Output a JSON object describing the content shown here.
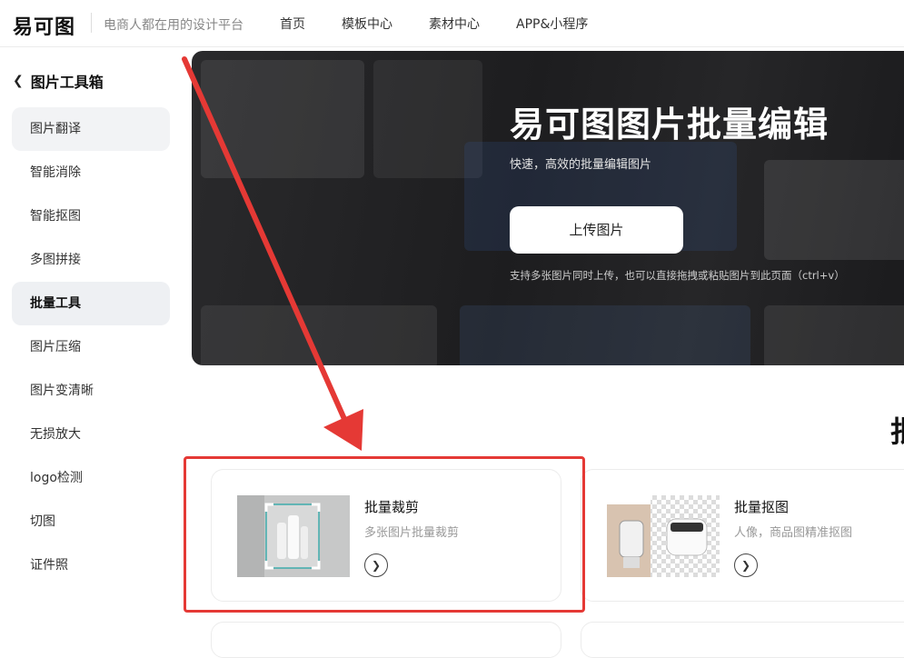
{
  "header": {
    "logo_text": "易可图",
    "slogan": "电商人都在用的设计平台",
    "nav": [
      "首页",
      "模板中心",
      "素材中心",
      "APP&小程序"
    ]
  },
  "sidebar": {
    "title": "图片工具箱",
    "items": [
      {
        "label": "图片翻译"
      },
      {
        "label": "智能消除"
      },
      {
        "label": "智能抠图"
      },
      {
        "label": "多图拼接"
      },
      {
        "label": "批量工具"
      },
      {
        "label": "图片压缩"
      },
      {
        "label": "图片变清晰"
      },
      {
        "label": "无损放大"
      },
      {
        "label": "logo检测"
      },
      {
        "label": "切图"
      },
      {
        "label": "证件照"
      }
    ]
  },
  "hero": {
    "title": "易可图图片批量编辑",
    "subtitle": "快速，高效的批量编辑图片",
    "upload_label": "上传图片",
    "hint": "支持多张图片同时上传，也可以直接拖拽或粘贴图片到此页面（ctrl+v）"
  },
  "section": {
    "heading_partial": "批"
  },
  "cards": [
    {
      "title": "批量裁剪",
      "desc": "多张图片批量裁剪"
    },
    {
      "title": "批量抠图",
      "desc": "人像，商品图精准抠图"
    }
  ],
  "colors": {
    "annotation_red": "#e53935",
    "hero_bg": "#1d1d1f"
  }
}
